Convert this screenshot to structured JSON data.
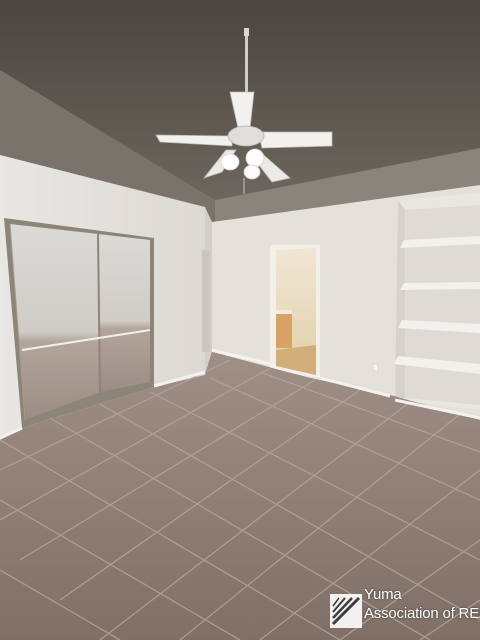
{
  "photo": {
    "subject": "empty bedroom",
    "colors": {
      "ceiling": "#5a544d",
      "wall": "#e6e3dd",
      "floor_tile": "#8c7b73",
      "grout": "#b09e95",
      "trim": "#f2f0ec"
    },
    "icons": [
      "ceiling-fan-icon",
      "mirrored-closet-icon",
      "shelf-icon"
    ]
  },
  "watermark": {
    "line1": "Yuma",
    "line2": "Association",
    "line3": "of REALTORS",
    "logo_icon": "yuma-realtors-logo-icon"
  }
}
